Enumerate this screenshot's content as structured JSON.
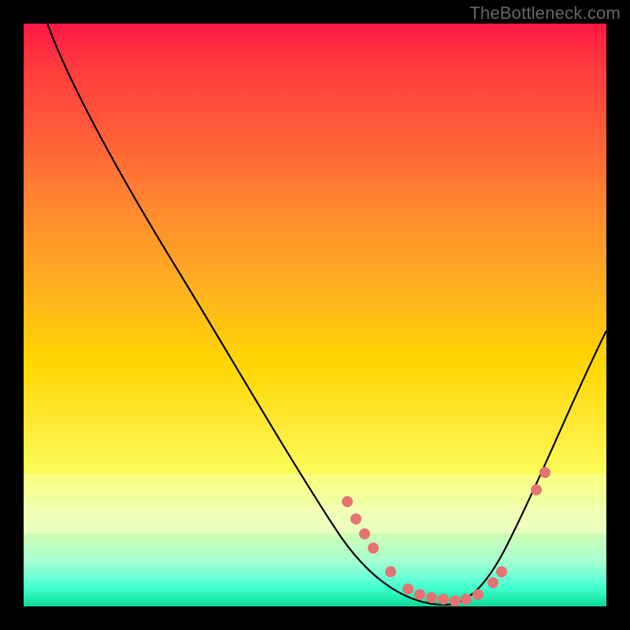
{
  "watermark": "TheBottleneck.com",
  "chart_data": {
    "type": "line",
    "title": "",
    "xlabel": "",
    "ylabel": "",
    "ylim": [
      0,
      100
    ],
    "xlim": [
      0,
      100
    ],
    "series": [
      {
        "name": "bottleneck-curve",
        "x": [
          4,
          10,
          20,
          30,
          40,
          50,
          55,
          58,
          62,
          66,
          70,
          74,
          78,
          80,
          85,
          90,
          95,
          100
        ],
        "y": [
          100,
          90,
          74,
          58,
          42,
          26,
          18,
          13,
          8,
          4,
          2,
          1,
          2,
          4,
          12,
          24,
          38,
          52
        ]
      }
    ],
    "marked_points": {
      "name": "highlight-dots",
      "description": "Salmon markers on the curve near the minimum and shoulders",
      "x": [
        55.5,
        57,
        58.5,
        60,
        63,
        66,
        68,
        70,
        72,
        74,
        76,
        78,
        80.5,
        82,
        88,
        89.5
      ],
      "y": [
        18,
        15,
        12.5,
        10,
        6,
        3,
        2,
        1.5,
        1.2,
        1,
        1.2,
        2,
        4,
        6,
        20,
        23
      ]
    },
    "background_gradient": {
      "description": "Vertical gradient from red (top / high bottleneck) through yellow to green (bottom / low bottleneck)",
      "stops": [
        "#ff1744",
        "#ffd600",
        "#19e8a8"
      ]
    }
  },
  "colors": {
    "dot": "#e57373",
    "curve": "#000000",
    "page_bg": "#000000",
    "watermark": "#666666"
  }
}
